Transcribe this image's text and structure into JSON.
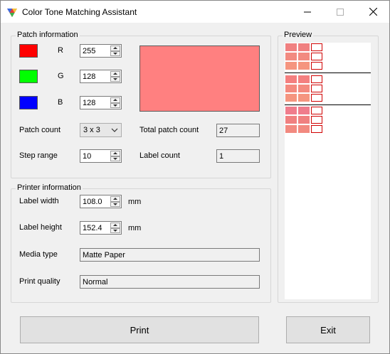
{
  "window": {
    "title": "Color Tone Matching Assistant",
    "accent_color": "#ff8080"
  },
  "patch_info": {
    "group_title": "Patch information",
    "r": {
      "label": "R",
      "value": "255",
      "swatch_color": "#ff0000"
    },
    "g": {
      "label": "G",
      "value": "128",
      "swatch_color": "#00ff00"
    },
    "b": {
      "label": "B",
      "value": "128",
      "swatch_color": "#0000ff"
    },
    "patch_count": {
      "label": "Patch count",
      "value": "3 x 3"
    },
    "step_range": {
      "label": "Step range",
      "value": "10"
    },
    "total_patch_count": {
      "label": "Total patch count",
      "value": "27"
    },
    "label_count": {
      "label": "Label count",
      "value": "1"
    }
  },
  "printer_info": {
    "group_title": "Printer information",
    "label_width": {
      "label": "Label width",
      "value": "108.0",
      "unit": "mm"
    },
    "label_height": {
      "label": "Label height",
      "value": "152.4",
      "unit": "mm"
    },
    "media_type": {
      "label": "Media type",
      "value": "Matte Paper"
    },
    "print_quality": {
      "label": "Print quality",
      "value": "Normal"
    }
  },
  "preview": {
    "group_title": "Preview",
    "blocks": [
      {
        "colors": [
          "#f08080",
          "#f08080",
          "#f28a80",
          "#f28a80",
          "#f5957f",
          "#f5957f"
        ]
      },
      {
        "colors": [
          "#f47f7f",
          "#f47f7f",
          "#f48a7f",
          "#f48a7f",
          "#f5957f",
          "#f5957f"
        ]
      },
      {
        "colors": [
          "#f07c8c",
          "#f07c8c",
          "#f08080",
          "#f08080",
          "#f28a80",
          "#f28a80"
        ]
      }
    ]
  },
  "buttons": {
    "print": "Print",
    "exit": "Exit"
  }
}
